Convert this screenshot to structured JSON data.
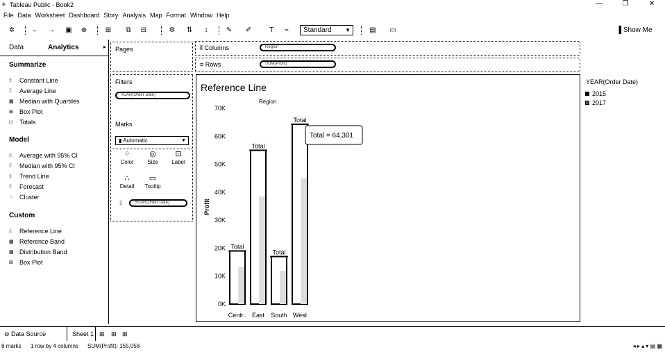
{
  "window": {
    "title": "Tableau Public - Book2",
    "controls": [
      "—",
      "❐",
      "✕"
    ]
  },
  "menu": [
    "File",
    "Data",
    "Worksheet",
    "Dashboard",
    "Story",
    "Analysis",
    "Map",
    "Format",
    "Window",
    "Help"
  ],
  "toolbar": {
    "fit": "Standard",
    "show_me": "Show Me"
  },
  "side": {
    "tabs": [
      "Data",
      "Analytics"
    ],
    "sections": [
      {
        "title": "Summarize",
        "items": [
          "Constant Line",
          "Average Line",
          "Median with Quartiles",
          "Box Plot",
          "Totals"
        ]
      },
      {
        "title": "Model",
        "items": [
          "Average with 95% CI",
          "Median with 95% CI",
          "Trend Line",
          "Forecast",
          "Cluster"
        ]
      },
      {
        "title": "Custom",
        "items": [
          "Reference Line",
          "Reference Band",
          "Distribution Band",
          "Box Plot"
        ]
      }
    ]
  },
  "cards": {
    "pages": "Pages",
    "filters": "Filters",
    "filter_pill": "YEAR(Order Date)",
    "marks": "Marks",
    "marks_type": "Automatic",
    "buttons": [
      "Color",
      "Size",
      "Label",
      "Detail",
      "Tooltip"
    ],
    "marks_pill": "YEAR(Order Date)"
  },
  "shelves": {
    "columns": "Columns",
    "columns_pill": "Region",
    "rows": "Rows",
    "rows_pill": "SUM(Profit)"
  },
  "view": {
    "title": "Reference Line",
    "tooltip": "Total = 64,301"
  },
  "legend": {
    "title": "YEAR(Order Date)",
    "items": [
      "2015",
      "2017"
    ]
  },
  "bottom": {
    "data_source": "Data Source",
    "sheet": "Sheet 1"
  },
  "status": {
    "marks": "8 marks",
    "rows_cols": "1 row by 4 columns",
    "sum": "SUM(Profit): 155,058"
  },
  "chart_data": {
    "type": "bar",
    "title": "Reference Line",
    "header": "Region",
    "categories": [
      "Centr..",
      "East",
      "South",
      "West"
    ],
    "series": [
      {
        "name": "Total",
        "values": [
          19000,
          55000,
          17000,
          64301
        ]
      }
    ],
    "bar_labels": [
      "Total",
      "Total",
      "Total",
      "Total"
    ],
    "ylabel": "Profit",
    "ylim": [
      0,
      70000
    ],
    "yticks": [
      "0K",
      "10K",
      "20K",
      "30K",
      "40K",
      "50K",
      "60K",
      "70K"
    ],
    "grid": false
  }
}
